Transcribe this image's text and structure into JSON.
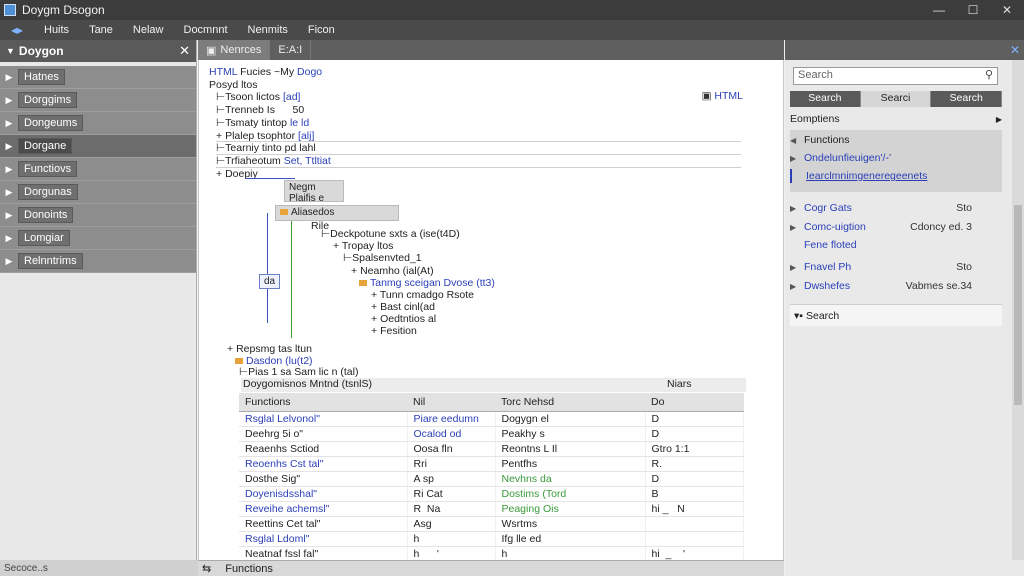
{
  "window": {
    "title": "Doygm Dsogon",
    "controls": [
      "—",
      "☐",
      "✕"
    ]
  },
  "menu": [
    "Huits",
    "Tane",
    "Nelaw",
    "Docmnnt",
    "Nenmits",
    "Ficon"
  ],
  "sidebar": {
    "title": "Doygon",
    "close": "✕",
    "items": [
      {
        "label": "Hatnes"
      },
      {
        "label": "Dorggims"
      },
      {
        "label": "Dongeums"
      },
      {
        "label": "Dorgane"
      },
      {
        "label": "Functiovs"
      },
      {
        "label": "Dorgunas"
      },
      {
        "label": "Donoints"
      },
      {
        "label": "Lomgiar"
      },
      {
        "label": "Relnntrims"
      }
    ]
  },
  "tabs": [
    {
      "label": "Nenrces"
    },
    {
      "label": "E:A:I"
    }
  ],
  "editor": {
    "html_tag": "HTML",
    "lines": {
      "l1a": "HTML",
      "l1b": "Fucies ~My",
      "l1c": "Dogo",
      "l2": "Posyd ltos",
      "l3a": "Tsoon lictos",
      "l3b": "[ad]",
      "l4a": "Trenneb Is",
      "l4b": "50",
      "l5a": "Tsmaty tintop",
      "l5b": "le ld",
      "l6a": "Plalep tsophtor",
      "l6b": "[alj]",
      "l7": "Tearniy tinto pd lahl",
      "l8a": "Trfiaheotum",
      "l8b": "Set, Ttltiat",
      "l9": "Doepiy",
      "n1": "Negm",
      "n2": "Plaifis e",
      "n3": "Aliasedos",
      "n4": "Rile",
      "n5": "Deckpotune sxts a (ise(t4D)",
      "n6": "Tropay ltos",
      "n7": "Spalsenvted_1",
      "n8": "Neamho (ial(At)",
      "n9": "Tanmg sceigan Dvose (tt3)",
      "n10": "Tunn cmadgo Rsote",
      "n11": "Bast cinl(ad",
      "n12": "Oedtntios al",
      "n13": "Fesition",
      "box_label": "da",
      "b1": "Repsmg tas ltun",
      "b2": "Dasdon (lu(t2)",
      "b3": "Pias 1 sa Sam lic n (tal)",
      "b4": "Doygomisnos Mntnd (tsnlS)"
    }
  },
  "table": {
    "right_header": "Niars",
    "headers": [
      "Functions",
      "Nil",
      "Torc Nehsd",
      "Do"
    ],
    "rows": [
      [
        "Rsglal Lelvonol\"",
        "Piare eedumn",
        "Dogygn el",
        "D"
      ],
      [
        "Deehrg 5i o\"",
        "Ocalod  od",
        "Peakhy s",
        "D"
      ],
      [
        "Reaenhs Sctiod",
        "Oosa fln",
        "Reontns  L    Il",
        "Gtro  1:1"
      ],
      [
        "Reoenhs Cst tal\"",
        "Rri",
        "Pentfhs",
        "R."
      ],
      [
        "Dosthe Sig\"",
        "A sp",
        "Nevhns da",
        "D"
      ],
      [
        "Doyenisdsshal\"",
        "Ri Cat",
        "Dostims  (Tord",
        "B"
      ],
      [
        "Reveihe achemsl\"",
        "R  Na",
        "Peaging Ois",
        "hi _   N"
      ],
      [
        "Reettins Cet tal\"",
        "Asg",
        "Wsrtms",
        ""
      ],
      [
        "Rsglal Ldoml\"",
        "h",
        "Ifg  lle ed",
        ""
      ],
      [
        "Neatnaf fssl fal\"",
        "h      '",
        "h",
        "hi  _    '"
      ]
    ]
  },
  "bottom": {
    "left": "Secoce..s",
    "tab_icon": "⇆",
    "tab_label": "Functions"
  },
  "right_panel": {
    "search_placeholder": "Search",
    "buttons": [
      "Search",
      "Searci",
      "Search"
    ],
    "section_title": "Eomptiens",
    "functions_title": "Functions",
    "func_items": [
      "Ondelunfieuigen'/-’",
      "Iearclmnimgeneregeenets"
    ],
    "rows": [
      {
        "name": "Cogr Gats",
        "value": "Sto"
      },
      {
        "name": "Comc-uigtion",
        "value": "Cdoncy ed. 3"
      },
      {
        "name": "Fene floted",
        "value": ""
      },
      {
        "name": "Fnavel Ph",
        "value": "Sto"
      },
      {
        "name": "Dwshefes",
        "value": "Vabmes se.34"
      }
    ],
    "search_label": "Search"
  },
  "colors": {
    "accent": "#2a3fb8",
    "titlebar": "#3c3c3c",
    "sidebar_item": "#8d8d8d"
  }
}
